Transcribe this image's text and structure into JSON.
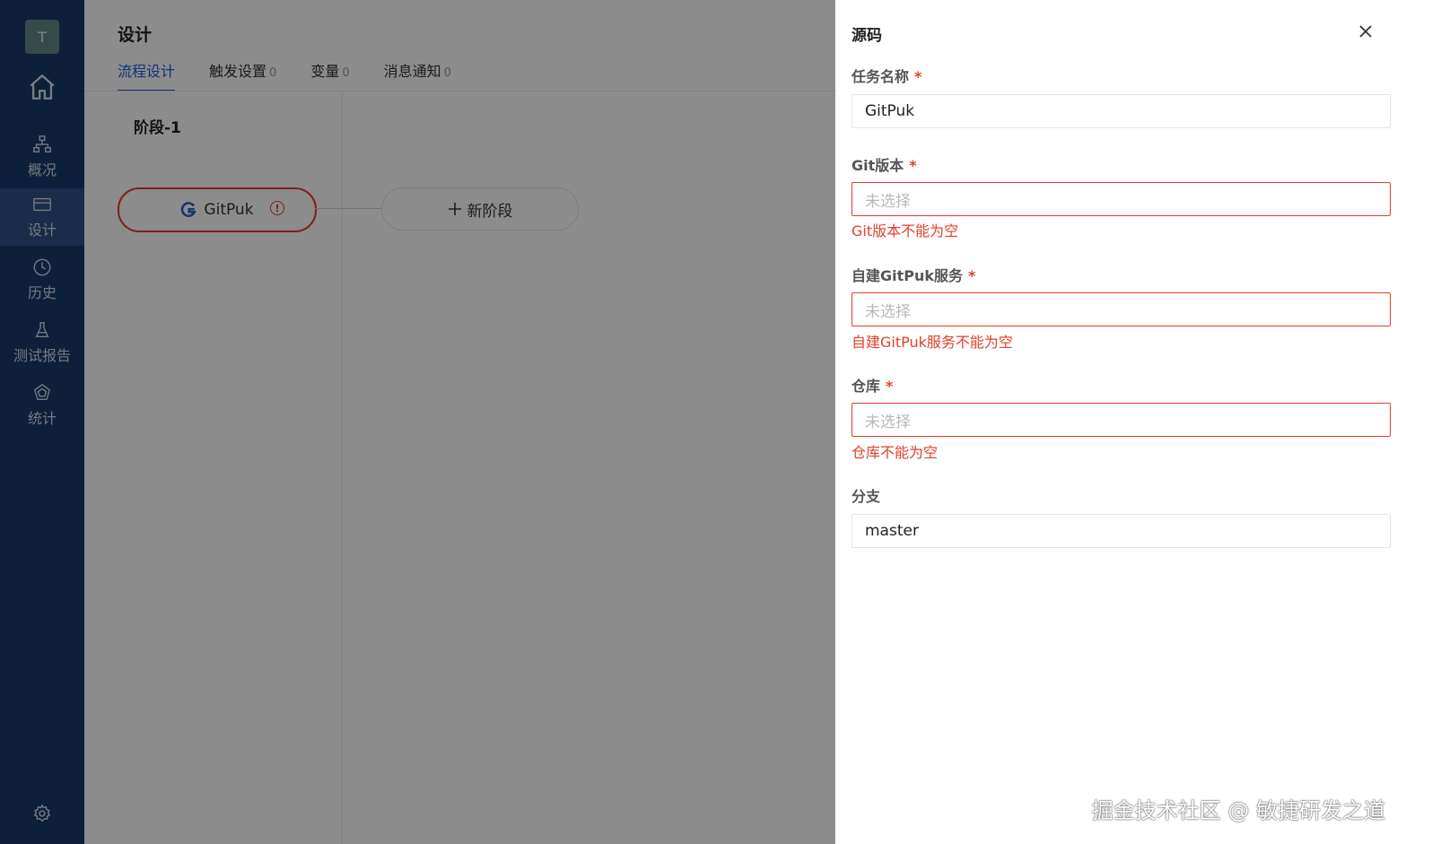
{
  "sidebar": {
    "avatar_letter": "T",
    "items": [
      {
        "label": "概况",
        "icon": "sitemap-icon"
      },
      {
        "label": "设计",
        "icon": "card-icon"
      },
      {
        "label": "历史",
        "icon": "clock-icon"
      },
      {
        "label": "测试报告",
        "icon": "flask-icon"
      },
      {
        "label": "统计",
        "icon": "chart-icon"
      }
    ],
    "active_index": 1
  },
  "main": {
    "title": "设计",
    "tabs": [
      {
        "label": "流程设计",
        "count": ""
      },
      {
        "label": "触发设置",
        "count": "0"
      },
      {
        "label": "变量",
        "count": "0"
      },
      {
        "label": "消息通知",
        "count": "0"
      }
    ],
    "stage_title": "阶段-1",
    "task_node_label": "GitPuk",
    "add_stage_label": "新阶段"
  },
  "drawer": {
    "title": "源码",
    "fields": {
      "task_name": {
        "label": "任务名称",
        "required": "*",
        "value": "GitPuk"
      },
      "git_version": {
        "label": "Git版本",
        "required": "*",
        "placeholder": "未选择",
        "error": "Git版本不能为空"
      },
      "gitpuk_service": {
        "label": "自建GitPuk服务",
        "required": "*",
        "placeholder": "未选择",
        "error": "自建GitPuk服务不能为空"
      },
      "repo": {
        "label": "仓库",
        "required": "*",
        "placeholder": "未选择",
        "error": "仓库不能为空"
      },
      "branch": {
        "label": "分支",
        "value": "master"
      }
    }
  },
  "watermark": "掘金技术社区 @ 敏捷研发之道",
  "colors": {
    "sidebar_bg": "#1b3a6b",
    "accent": "#1f5bd6",
    "error": "#e0402e"
  }
}
